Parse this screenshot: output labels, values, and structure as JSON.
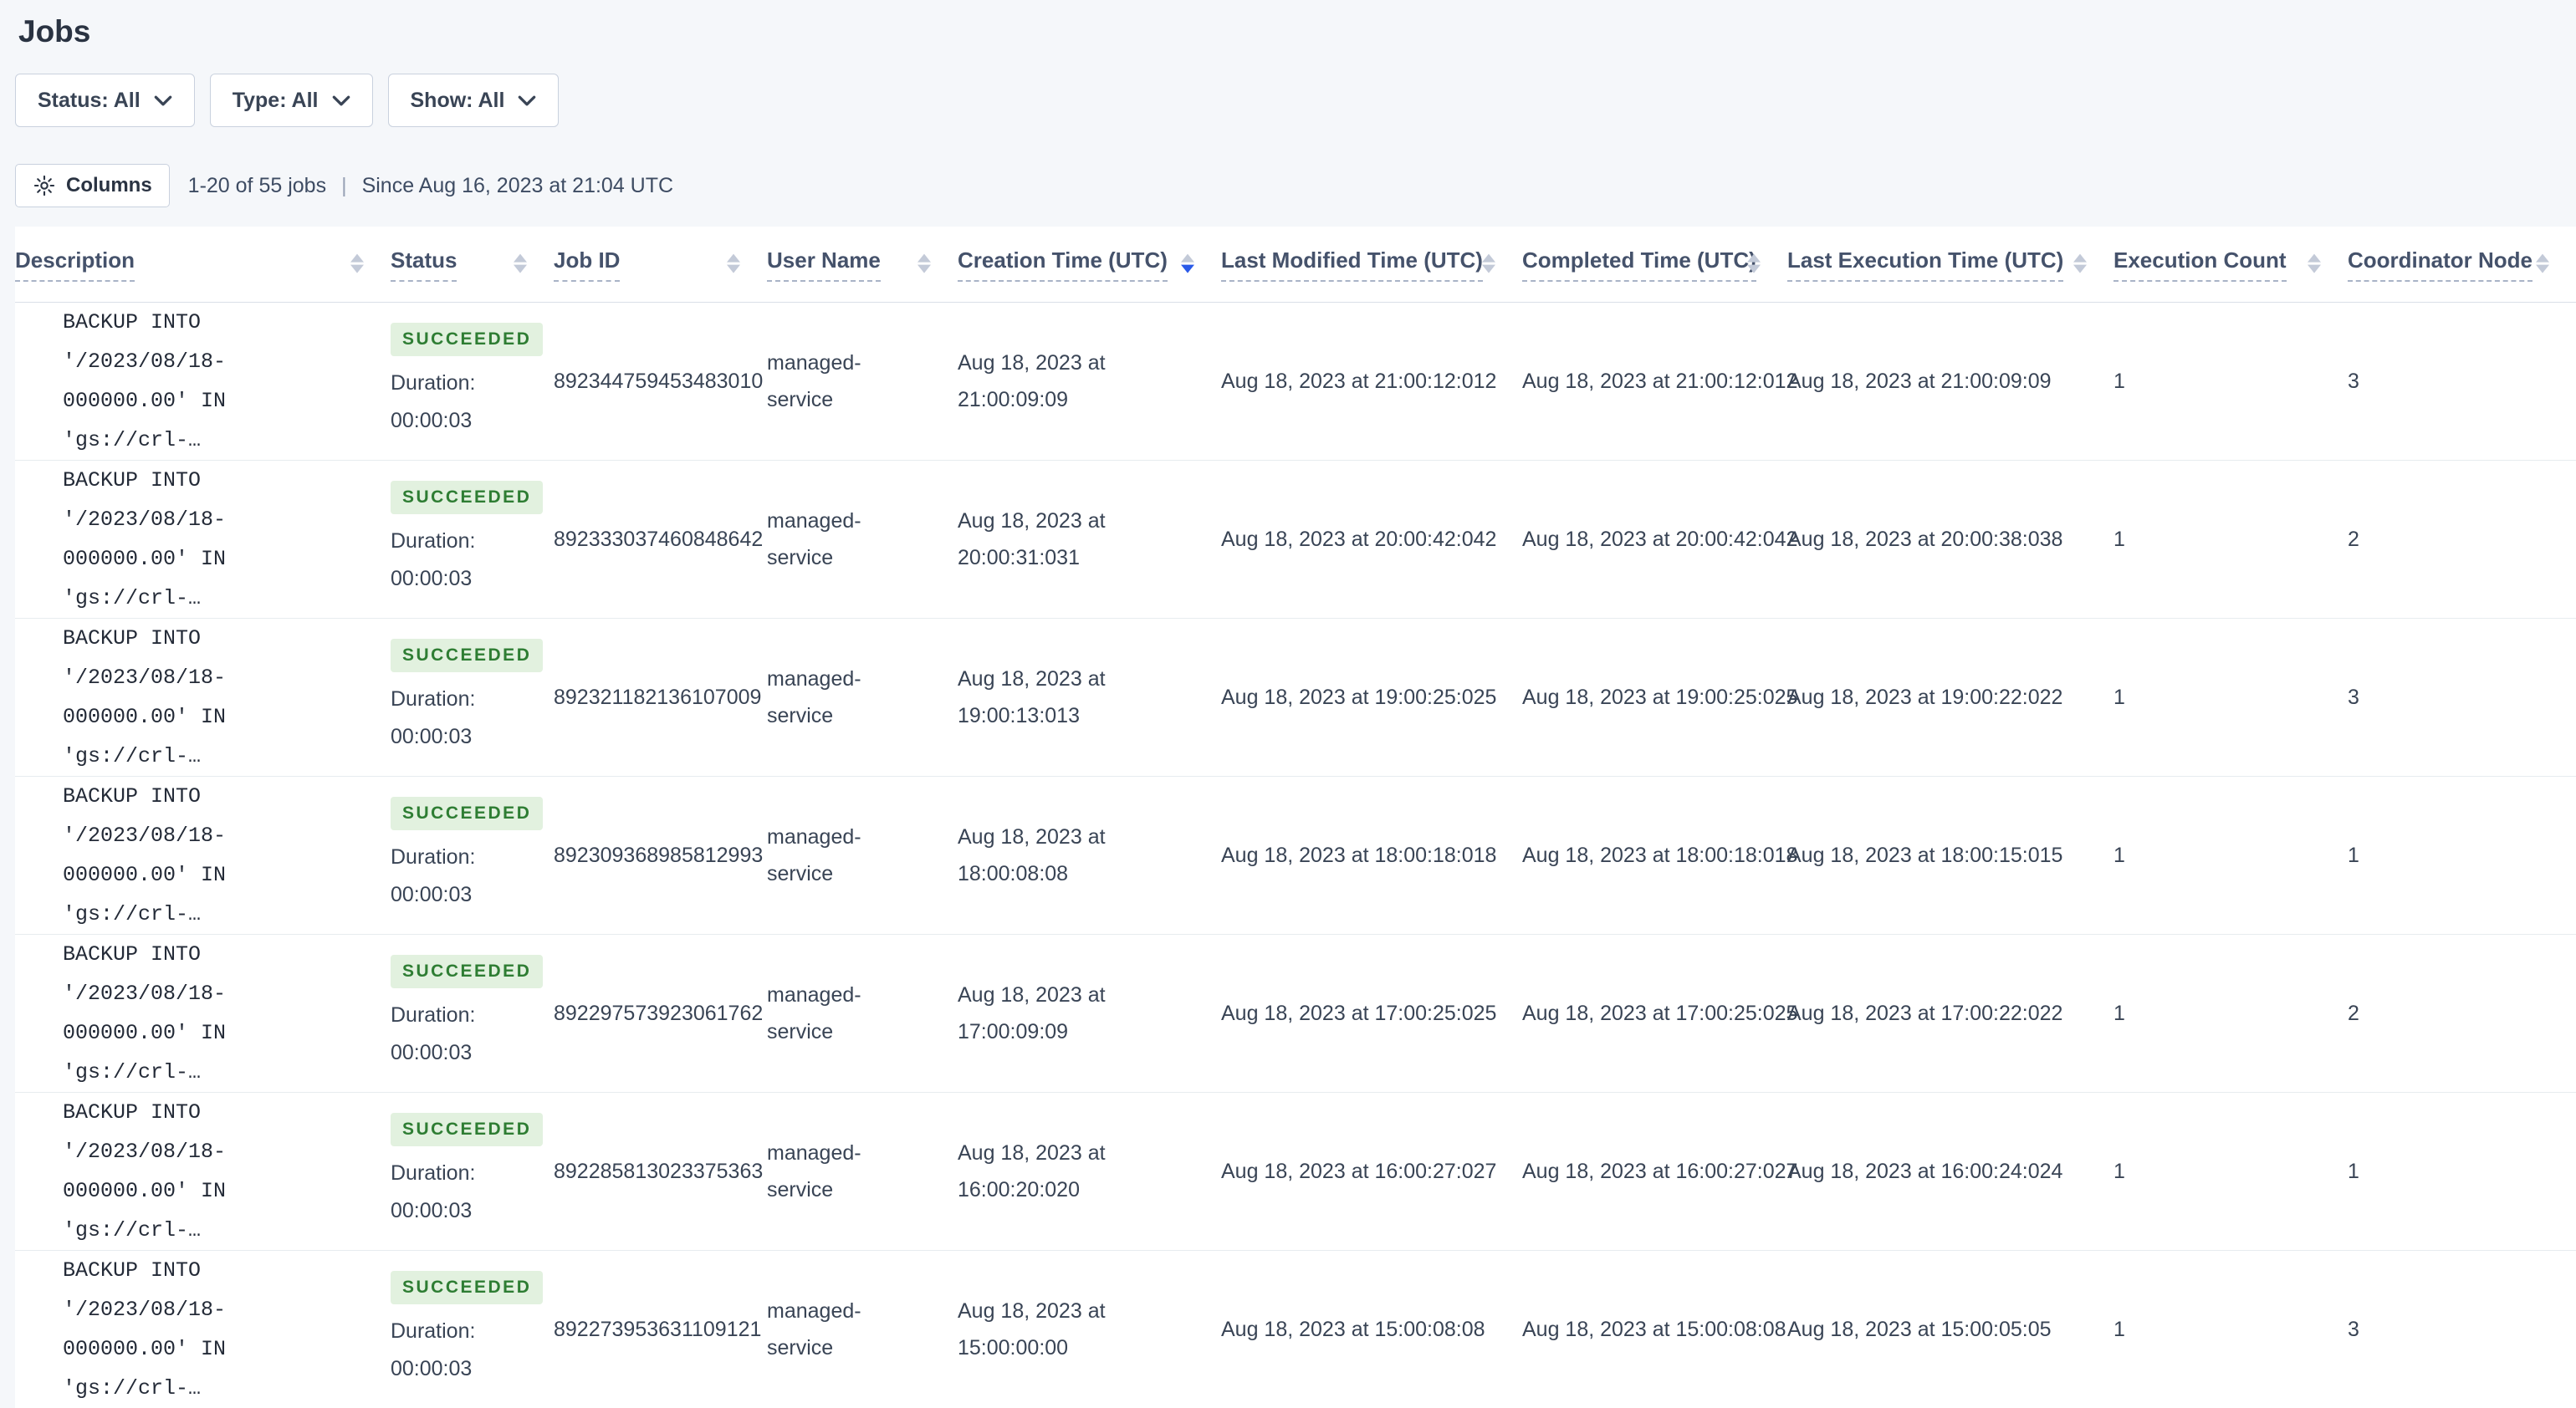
{
  "page": {
    "title": "Jobs"
  },
  "filters": [
    {
      "label": "Status: All"
    },
    {
      "label": "Type: All"
    },
    {
      "label": "Show: All"
    }
  ],
  "toolbar": {
    "columns_button": "Columns",
    "results_count": "1-20 of 55 jobs",
    "separator": "|",
    "since": "Since Aug 16, 2023 at 21:04 UTC"
  },
  "table": {
    "columns": [
      {
        "label": "Description",
        "sort": "none"
      },
      {
        "label": "Status",
        "sort": "none"
      },
      {
        "label": "Job ID",
        "sort": "none"
      },
      {
        "label": "User Name",
        "sort": "none"
      },
      {
        "label": "Creation Time (UTC)",
        "sort": "desc"
      },
      {
        "label": "Last Modified Time (UTC)",
        "sort": "none"
      },
      {
        "label": "Completed Time (UTC)",
        "sort": "none"
      },
      {
        "label": "Last Execution Time (UTC)",
        "sort": "none"
      },
      {
        "label": "Execution Count",
        "sort": "none"
      },
      {
        "label": "Coordinator Node",
        "sort": "none"
      }
    ],
    "rows": [
      {
        "description_line1": "BACKUP INTO '/2023/08/18-",
        "description_line2": "000000.00' IN 'gs://crl-…",
        "status": "SUCCEEDED",
        "duration_label": "Duration:",
        "duration_value": "00:00:03",
        "job_id": "892344759453483010",
        "user_name": "managed-service",
        "creation_time": "Aug 18, 2023 at 21:00:09:09",
        "last_modified_time": "Aug 18, 2023 at 21:00:12:012",
        "completed_time": "Aug 18, 2023 at 21:00:12:012",
        "last_execution_time": "Aug 18, 2023 at 21:00:09:09",
        "execution_count": "1",
        "coordinator_node": "3"
      },
      {
        "description_line1": "BACKUP INTO '/2023/08/18-",
        "description_line2": "000000.00' IN 'gs://crl-…",
        "status": "SUCCEEDED",
        "duration_label": "Duration:",
        "duration_value": "00:00:03",
        "job_id": "892333037460848642",
        "user_name": "managed-service",
        "creation_time": "Aug 18, 2023 at 20:00:31:031",
        "last_modified_time": "Aug 18, 2023 at 20:00:42:042",
        "completed_time": "Aug 18, 2023 at 20:00:42:042",
        "last_execution_time": "Aug 18, 2023 at 20:00:38:038",
        "execution_count": "1",
        "coordinator_node": "2"
      },
      {
        "description_line1": "BACKUP INTO '/2023/08/18-",
        "description_line2": "000000.00' IN 'gs://crl-…",
        "status": "SUCCEEDED",
        "duration_label": "Duration:",
        "duration_value": "00:00:03",
        "job_id": "892321182136107009",
        "user_name": "managed-service",
        "creation_time": "Aug 18, 2023 at 19:00:13:013",
        "last_modified_time": "Aug 18, 2023 at 19:00:25:025",
        "completed_time": "Aug 18, 2023 at 19:00:25:025",
        "last_execution_time": "Aug 18, 2023 at 19:00:22:022",
        "execution_count": "1",
        "coordinator_node": "3"
      },
      {
        "description_line1": "BACKUP INTO '/2023/08/18-",
        "description_line2": "000000.00' IN 'gs://crl-…",
        "status": "SUCCEEDED",
        "duration_label": "Duration:",
        "duration_value": "00:00:03",
        "job_id": "892309368985812993",
        "user_name": "managed-service",
        "creation_time": "Aug 18, 2023 at 18:00:08:08",
        "last_modified_time": "Aug 18, 2023 at 18:00:18:018",
        "completed_time": "Aug 18, 2023 at 18:00:18:018",
        "last_execution_time": "Aug 18, 2023 at 18:00:15:015",
        "execution_count": "1",
        "coordinator_node": "1"
      },
      {
        "description_line1": "BACKUP INTO '/2023/08/18-",
        "description_line2": "000000.00' IN 'gs://crl-…",
        "status": "SUCCEEDED",
        "duration_label": "Duration:",
        "duration_value": "00:00:03",
        "job_id": "892297573923061762",
        "user_name": "managed-service",
        "creation_time": "Aug 18, 2023 at 17:00:09:09",
        "last_modified_time": "Aug 18, 2023 at 17:00:25:025",
        "completed_time": "Aug 18, 2023 at 17:00:25:025",
        "last_execution_time": "Aug 18, 2023 at 17:00:22:022",
        "execution_count": "1",
        "coordinator_node": "2"
      },
      {
        "description_line1": "BACKUP INTO '/2023/08/18-",
        "description_line2": "000000.00' IN 'gs://crl-…",
        "status": "SUCCEEDED",
        "duration_label": "Duration:",
        "duration_value": "00:00:03",
        "job_id": "892285813023375363",
        "user_name": "managed-service",
        "creation_time": "Aug 18, 2023 at 16:00:20:020",
        "last_modified_time": "Aug 18, 2023 at 16:00:27:027",
        "completed_time": "Aug 18, 2023 at 16:00:27:027",
        "last_execution_time": "Aug 18, 2023 at 16:00:24:024",
        "execution_count": "1",
        "coordinator_node": "1"
      },
      {
        "description_line1": "BACKUP INTO '/2023/08/18-",
        "description_line2": "000000.00' IN 'gs://crl-…",
        "status": "SUCCEEDED",
        "duration_label": "Duration:",
        "duration_value": "00:00:03",
        "job_id": "892273953631109121",
        "user_name": "managed-service",
        "creation_time": "Aug 18, 2023 at 15:00:00:00",
        "last_modified_time": "Aug 18, 2023 at 15:00:08:08",
        "completed_time": "Aug 18, 2023 at 15:00:08:08",
        "last_execution_time": "Aug 18, 2023 at 15:00:05:05",
        "execution_count": "1",
        "coordinator_node": "3"
      }
    ]
  },
  "colors": {
    "page_background": "#F5F7FA",
    "card_background": "#FFFFFF",
    "success_badge_bg": "#E2F1DF",
    "success_badge_text": "#2E7D33",
    "sort_active": "#2A5AE8",
    "sort_inactive": "#C3CAD8",
    "row_border": "#E7ECEF",
    "heading_text": "#2A3342",
    "body_text": "#394455"
  }
}
